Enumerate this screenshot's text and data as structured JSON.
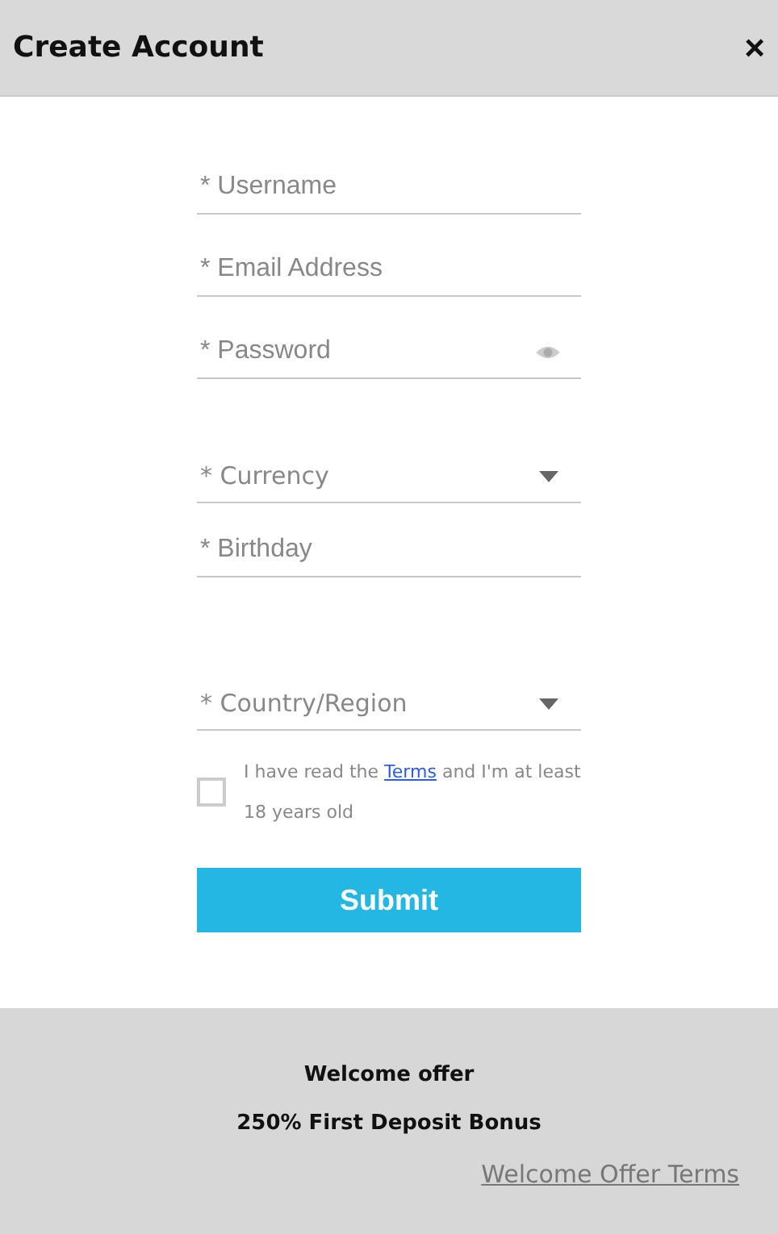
{
  "header": {
    "title": "Create Account",
    "close": "×"
  },
  "fields": [
    {
      "kind": "text",
      "placeholder": "* Username"
    },
    {
      "kind": "text",
      "placeholder": "* Email Address"
    },
    {
      "kind": "password",
      "placeholder": "* Password"
    },
    {
      "kind": "select",
      "placeholder": "* Currency"
    },
    {
      "kind": "text",
      "placeholder": "* Birthday"
    },
    {
      "kind": "select",
      "placeholder": "* Country/Region"
    }
  ],
  "agreement": {
    "checked": false,
    "text_before": "I have read the ",
    "link": "Terms",
    "text_after": " and I'm at least 18 years old"
  },
  "submit": "Submit",
  "footer": {
    "title": "Welcome offer",
    "bonus": "250% First Deposit Bonus",
    "link": "Welcome Offer Terms"
  }
}
